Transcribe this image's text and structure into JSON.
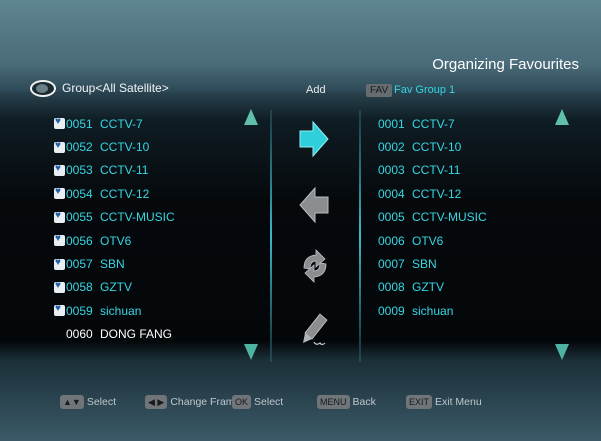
{
  "header": {
    "title": "Organizing Favourites",
    "group_label": "Group<All Satellite>"
  },
  "middle": {
    "add_label": "Add"
  },
  "fav": {
    "badge": "FAV",
    "group_name": "Fav Group 1"
  },
  "left_list": [
    {
      "num": "0051",
      "name": "CCTV-7",
      "fav": true
    },
    {
      "num": "0052",
      "name": "CCTV-10",
      "fav": true
    },
    {
      "num": "0053",
      "name": "CCTV-11",
      "fav": true
    },
    {
      "num": "0054",
      "name": "CCTV-12",
      "fav": true
    },
    {
      "num": "0055",
      "name": "CCTV-MUSIC",
      "fav": true
    },
    {
      "num": "0056",
      "name": "OTV6",
      "fav": true
    },
    {
      "num": "0057",
      "name": "SBN",
      "fav": true
    },
    {
      "num": "0058",
      "name": "GZTV",
      "fav": true
    },
    {
      "num": "0059",
      "name": "sichuan",
      "fav": true
    },
    {
      "num": "0060",
      "name": "DONG FANG",
      "fav": false
    }
  ],
  "right_list": [
    {
      "num": "0001",
      "name": "CCTV-7"
    },
    {
      "num": "0002",
      "name": "CCTV-10"
    },
    {
      "num": "0003",
      "name": "CCTV-11"
    },
    {
      "num": "0004",
      "name": "CCTV-12"
    },
    {
      "num": "0005",
      "name": "CCTV-MUSIC"
    },
    {
      "num": "0006",
      "name": "OTV6"
    },
    {
      "num": "0007",
      "name": "SBN"
    },
    {
      "num": "0008",
      "name": "GZTV"
    },
    {
      "num": "0009",
      "name": "sichuan"
    }
  ],
  "footer": {
    "select1": "Select",
    "change_fram": "Change Fram",
    "ok_key": "OK",
    "select2": "Select",
    "menu_key": "MENU",
    "back": "Back",
    "exit_key": "EXIT",
    "exit_menu": "Exit Menu"
  },
  "colors": {
    "cyan_text": "#37d6e2",
    "arrow_add": "#2fd0dc",
    "arrow_gray": "#8a8e90"
  },
  "icons": {
    "add": "right-arrow-icon",
    "remove": "left-arrow-icon",
    "move": "swap-arrows-icon",
    "rename": "pencil-icon",
    "satellite": "satellite-dish-icon"
  }
}
